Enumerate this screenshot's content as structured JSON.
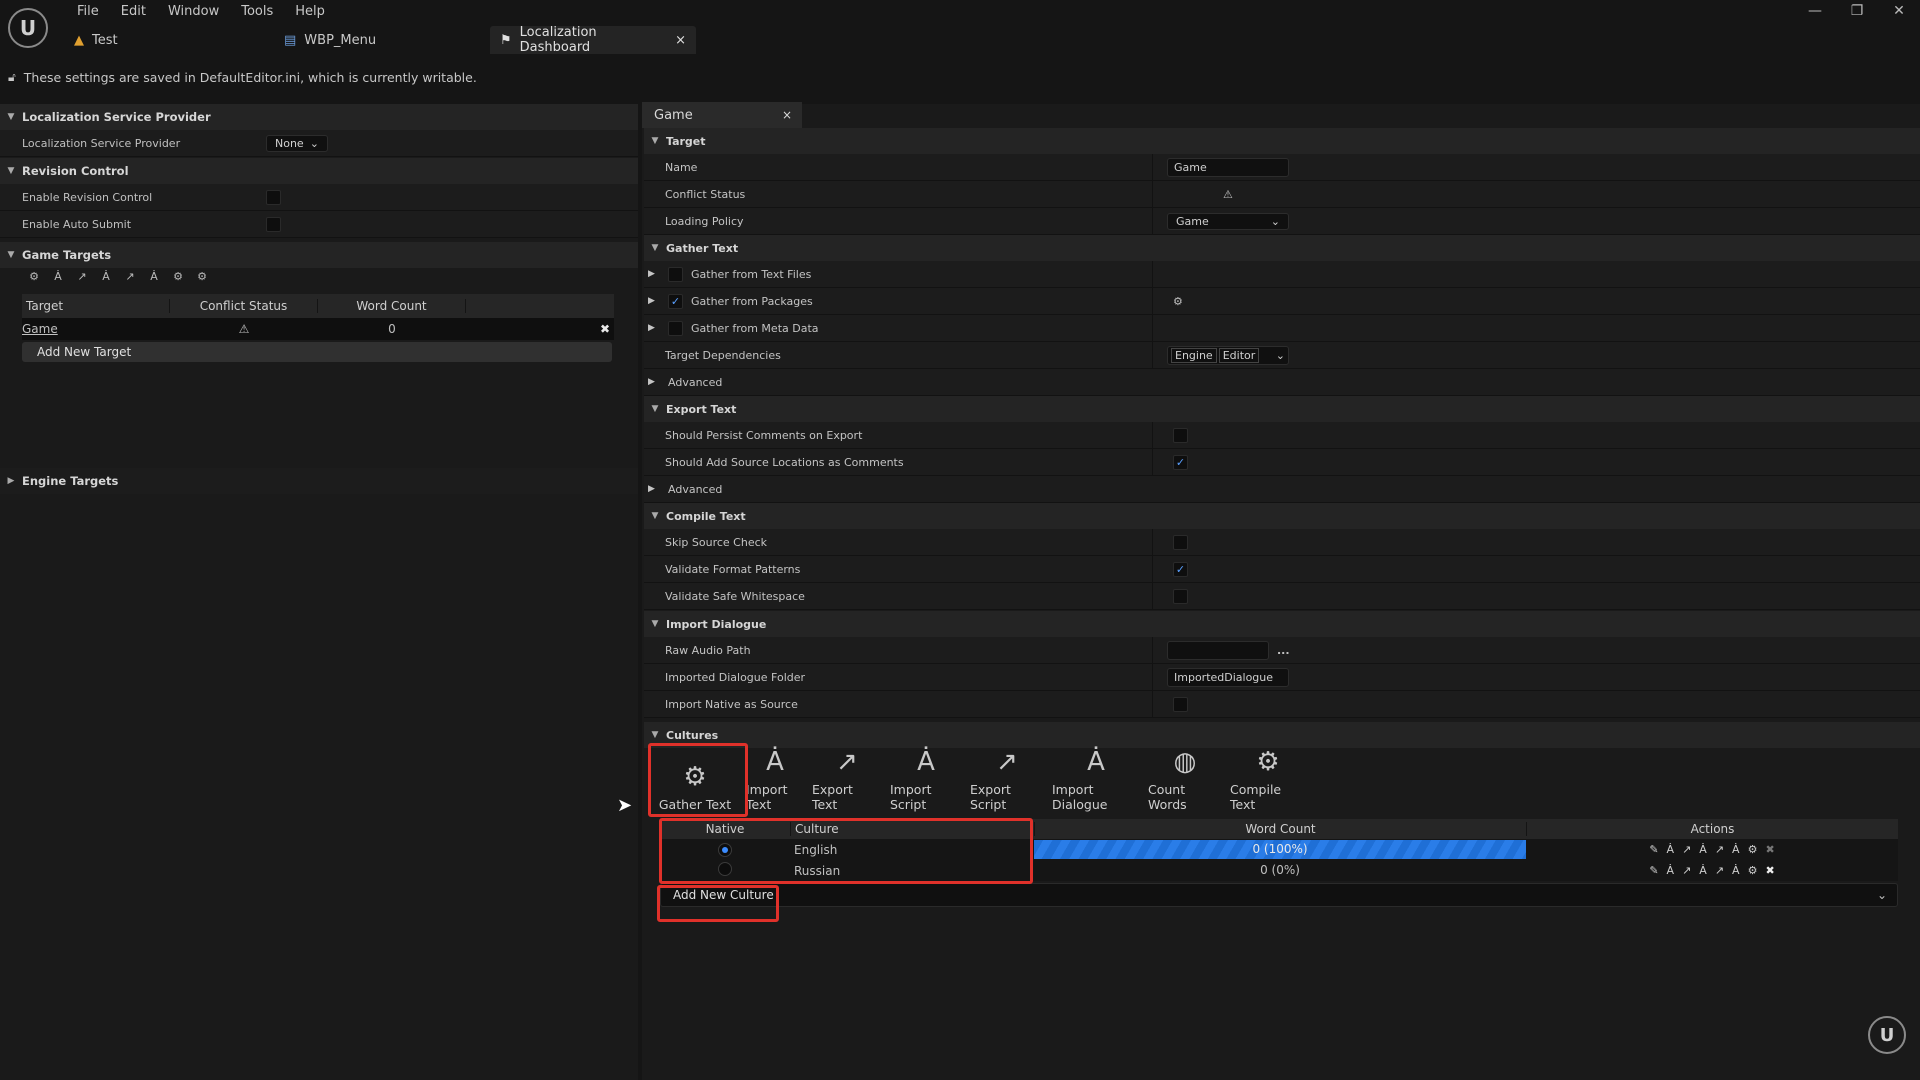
{
  "menu": [
    "File",
    "Edit",
    "Window",
    "Tools",
    "Help"
  ],
  "tabs": [
    {
      "label": "Test",
      "icon": "level-icon"
    },
    {
      "label": "WBP_Menu",
      "icon": "widget-blueprint-icon"
    },
    {
      "label": "Localization Dashboard",
      "icon": "flag-icon",
      "close": "×"
    }
  ],
  "notice": "These settings are saved in DefaultEditor.ini, which is currently writable.",
  "left": {
    "sections": {
      "service": "Localization Service Provider",
      "revision": "Revision Control",
      "game_targets": "Game Targets",
      "engine_targets": "Engine Targets"
    },
    "service_label": "Localization Service Provider",
    "service_value": "None",
    "enable_revision": "Enable Revision Control",
    "enable_auto_submit": "Enable Auto Submit",
    "table": {
      "headers": [
        "Target",
        "Conflict Status",
        "Word Count"
      ],
      "row": {
        "target": "Game",
        "word_count": "0"
      },
      "add_button": "Add New Target"
    }
  },
  "right": {
    "tab": "Game",
    "tab_close": "×",
    "sections": {
      "target": "Target",
      "gather": "Gather Text",
      "export": "Export Text",
      "compile": "Compile Text",
      "import_dialogue": "Import Dialogue",
      "cultures": "Cultures"
    },
    "name_label": "Name",
    "name_value": "Game",
    "conflict_label": "Conflict Status",
    "loading_label": "Loading Policy",
    "loading_value": "Game",
    "gather_text_files": "Gather from Text Files",
    "gather_packages": "Gather from Packages",
    "gather_meta": "Gather from Meta Data",
    "target_deps": "Target Dependencies",
    "deps": [
      "Engine",
      "Editor"
    ],
    "advanced": "Advanced",
    "persist_comments": "Should Persist Comments on Export",
    "source_locations": "Should Add Source Locations as Comments",
    "skip_source": "Skip Source Check",
    "validate_format": "Validate Format Patterns",
    "validate_whitespace": "Validate Safe Whitespace",
    "raw_audio": "Raw Audio Path",
    "raw_audio_btn": "...",
    "imported_folder": "Imported Dialogue Folder",
    "imported_folder_value": "ImportedDialogue",
    "import_native": "Import Native as Source",
    "toolbar": [
      "Gather Text",
      "Import Text",
      "Export Text",
      "Import Script",
      "Export Script",
      "Import Dialogue",
      "Count Words",
      "Compile Text"
    ],
    "culture_table": {
      "headers": [
        "Native",
        "Culture",
        "Word Count",
        "Actions"
      ],
      "rows": [
        {
          "culture": "English",
          "word_count": "0 (100%)",
          "progress": 1.0,
          "native": true
        },
        {
          "culture": "Russian",
          "word_count": "0 (0%)",
          "progress": 0.0,
          "native": false
        }
      ],
      "add_button": "Add New Culture"
    }
  },
  "colors": {
    "accent": "#1f6fd6",
    "highlight": "#e0312a"
  }
}
